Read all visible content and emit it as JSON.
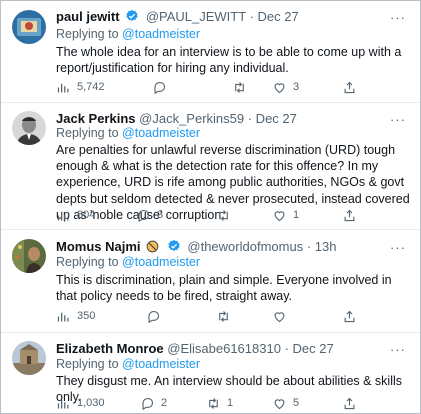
{
  "reply_prefix": "Replying to",
  "tweets": [
    {
      "name": "paul jewitt",
      "handle": "@PAUL_JEWITT",
      "date": "· Dec 27",
      "replying_to": "@toadmeister",
      "text": "The whole idea for an interview is to be able to come up with a report/justification for hiring any individual.",
      "views": "5,742",
      "replies": "",
      "retweets": "",
      "likes": "3"
    },
    {
      "name": "Jack Perkins",
      "handle": "@Jack_Perkins59",
      "date": "· Dec 27",
      "replying_to": "@toadmeister",
      "text": "Are penalties for unlawful reverse discrimination (URD) tough enough & what is the detection rate for this offence? In my experience, URD is rife among public authorities, NGOs & govt depts but seldom detected & never prosecuted, instead covered up as 'noble cause' corruption.",
      "views": "804",
      "replies": "3",
      "retweets": "",
      "likes": "1"
    },
    {
      "name": "Momus Najmi",
      "handle": "@theworldofmomus",
      "date": "· 13h",
      "replying_to": "@toadmeister",
      "text": "This is discrimination, plain and simple. Everyone involved in that policy needs to be fired, straight away.",
      "views": "350",
      "replies": "",
      "retweets": "",
      "likes": ""
    },
    {
      "name": "Elizabeth Monroe",
      "handle": "@Elisabe61618310",
      "date": "· Dec 27",
      "replying_to": "@toadmeister",
      "text": "They disgust me. An interview should be about abilities & skills only.",
      "views": "1,030",
      "replies": "2",
      "retweets": "1",
      "likes": "5"
    }
  ],
  "colors": {
    "link": "#1d9bf0",
    "verified": "#1d9bf0",
    "secondary_text": "#536471",
    "primary_text": "#0f1419"
  },
  "icons": [
    "verified-badge-icon",
    "reply-icon",
    "retweet-icon",
    "like-icon",
    "views-icon",
    "share-icon",
    "more-icon"
  ]
}
